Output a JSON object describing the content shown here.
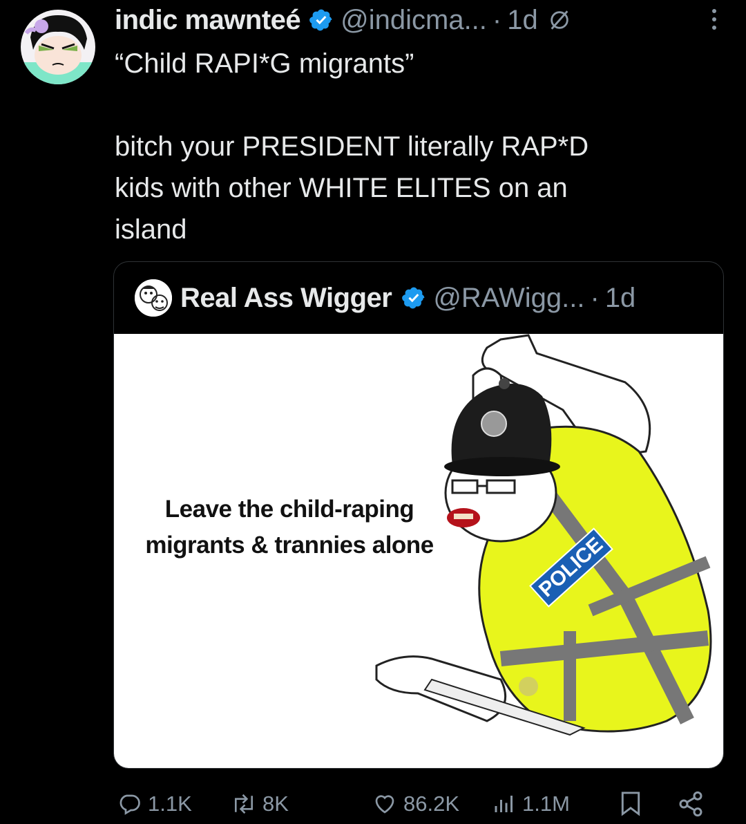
{
  "tweet": {
    "author_name": "indic mawnteé",
    "author_handle": "@indicma...",
    "dot": "·",
    "time": "1d",
    "text_lines": [
      "“Child RAPI*G migrants”",
      "",
      "bitch your PRESIDENT literally RAP*D",
      "kids with other WHITE ELITES on an",
      "island"
    ]
  },
  "quote": {
    "author_name": "Real Ass Wigger",
    "author_handle": "@RAWigg...",
    "dot": "·",
    "time": "1d",
    "image": {
      "caption_lines": [
        "Leave the child-raping",
        "migrants & trannies alone"
      ],
      "vest_label": "POLICE"
    }
  },
  "actions": {
    "replies": "1.1K",
    "reposts": "8K",
    "likes": "86.2K",
    "views": "1.1M"
  },
  "colors": {
    "background": "#000000",
    "text": "#e7e9ea",
    "muted": "#8b98a5",
    "verified": "#1d9bf0",
    "vest": "#e8f51c"
  },
  "icons": [
    "verified-badge-icon",
    "grok-icon",
    "more-icon",
    "reply-icon",
    "repost-icon",
    "like-icon",
    "views-icon",
    "bookmark-icon",
    "share-icon"
  ]
}
